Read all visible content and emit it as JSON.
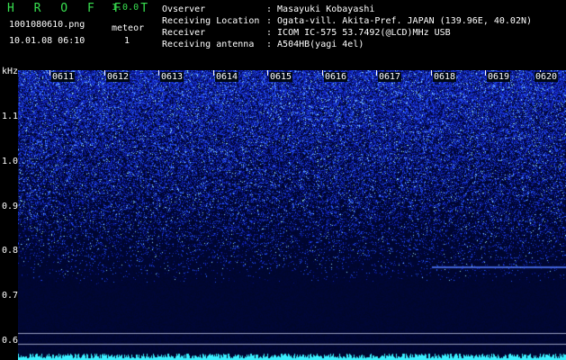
{
  "header": {
    "brand": "H R O F F T",
    "version": "1.0.0",
    "filename": "1001080610.png",
    "datetime": "10.01.08 06:10",
    "meteor_label": "meteor",
    "meteor_count": "1"
  },
  "info": [
    {
      "key": "Ovserver",
      "value": ": Masayuki Kobayashi"
    },
    {
      "key": "Receiving Location",
      "value": ": Ogata-vill. Akita-Pref. JAPAN (139.96E, 40.02N)"
    },
    {
      "key": "Receiver",
      "value": ": ICOM IC-575 53.7492(@LCD)MHz USB"
    },
    {
      "key": "Receiving antenna",
      "value": ": A504HB(yagi 4el)"
    }
  ],
  "y_axis": {
    "unit": "kHz",
    "ticks": [
      "1.1",
      "1.0",
      "0.9",
      "0.8",
      "0.7",
      "0.6"
    ]
  },
  "x_axis": {
    "ticks": [
      "0611",
      "0612",
      "0613",
      "0614",
      "0615",
      "0616",
      "0617",
      "0618",
      "0619",
      "0620"
    ]
  },
  "colors": {
    "brand": "#38e050",
    "noise_strong": "#3c64ff",
    "noise_bright": "#9ee8ff",
    "floor": "#000a3a",
    "trace": "#3af0ff"
  }
}
